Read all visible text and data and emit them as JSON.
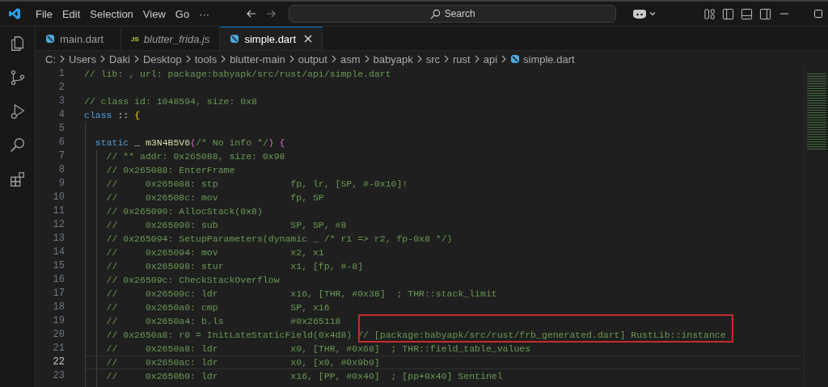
{
  "title_bar": {
    "menu": [
      "File",
      "Edit",
      "Selection",
      "View",
      "Go",
      "···"
    ],
    "search": {
      "placeholder": "Search"
    }
  },
  "tabs": [
    {
      "label": "main.dart",
      "kind": "dart",
      "selected": false,
      "preview": false
    },
    {
      "label": "blutter_frida.js",
      "kind": "js",
      "badge": "JS",
      "selected": false,
      "preview": true
    },
    {
      "label": "simple.dart",
      "kind": "dart",
      "selected": true,
      "preview": false
    }
  ],
  "breadcrumbs": [
    "C:",
    "Users",
    "Daki",
    "Desktop",
    "tools",
    "blutter-main",
    "output",
    "asm",
    "babyapk",
    "src",
    "rust",
    "api",
    "simple.dart"
  ],
  "editor": {
    "lines": [
      {
        "number": "1",
        "current": false,
        "tokens": [
          {
            "kind": "comment",
            "text": "// lib: , url: package:babyapk/src/rust/api/simple.dart"
          }
        ]
      },
      {
        "number": "2",
        "current": false
      },
      {
        "number": "3",
        "current": false,
        "tokens": [
          {
            "kind": "comment",
            "text": "// class id: 1048594, size: 0x8"
          }
        ]
      },
      {
        "number": "4",
        "current": false,
        "tokens": [
          {
            "kind": "keyword",
            "text": "class"
          },
          {
            "kind": "plain",
            "text": " :: "
          },
          {
            "kind": "brace",
            "text": "{"
          }
        ]
      },
      {
        "number": "5",
        "current": false
      },
      {
        "number": "6",
        "current": false,
        "tokens": [
          {
            "kind": "keyword",
            "text": "  static"
          },
          {
            "kind": "plain",
            "text": " _ "
          },
          {
            "kind": "function",
            "text": "m3N4B5V6"
          },
          {
            "kind": "paren",
            "text": "("
          },
          {
            "kind": "comment",
            "text": "/* No info */"
          },
          {
            "kind": "paren",
            "text": ") {"
          }
        ]
      },
      {
        "number": "7",
        "current": false,
        "tokens": [
          {
            "kind": "comment",
            "text": "    // ** addr: 0x265088, size: 0x98"
          }
        ]
      },
      {
        "number": "8",
        "current": false,
        "tokens": [
          {
            "kind": "comment",
            "text": "    // 0x265088: EnterFrame"
          }
        ]
      },
      {
        "number": "9",
        "current": false,
        "tokens": [
          {
            "kind": "comment",
            "text": "    //     0x265088: stp             fp, lr, [SP, #-0x10]!"
          }
        ]
      },
      {
        "number": "10",
        "current": false,
        "tokens": [
          {
            "kind": "comment",
            "text": "    //     0x26508c: mov             fp, SP"
          }
        ]
      },
      {
        "number": "11",
        "current": false,
        "tokens": [
          {
            "kind": "comment",
            "text": "    // 0x265090: AllocStack(0x8)"
          }
        ]
      },
      {
        "number": "12",
        "current": false,
        "tokens": [
          {
            "kind": "comment",
            "text": "    //     0x265090: sub             SP, SP, #8"
          }
        ]
      },
      {
        "number": "13",
        "current": false,
        "tokens": [
          {
            "kind": "comment",
            "text": "    // 0x265094: SetupParameters(dynamic _ /* r1 => r2, fp-0x8 */)"
          }
        ]
      },
      {
        "number": "14",
        "current": false,
        "tokens": [
          {
            "kind": "comment",
            "text": "    //     0x265094: mov             x2, x1"
          }
        ]
      },
      {
        "number": "15",
        "current": false,
        "tokens": [
          {
            "kind": "comment",
            "text": "    //     0x265098: stur            x1, [fp, #-8]"
          }
        ]
      },
      {
        "number": "16",
        "current": false,
        "tokens": [
          {
            "kind": "comment",
            "text": "    // 0x26509c: CheckStackOverflow"
          }
        ]
      },
      {
        "number": "17",
        "current": false,
        "tokens": [
          {
            "kind": "comment",
            "text": "    //     0x26509c: ldr             x16, [THR, #0x38]  ; THR::stack_limit"
          }
        ]
      },
      {
        "number": "18",
        "current": false,
        "tokens": [
          {
            "kind": "comment",
            "text": "    //     0x2650a0: cmp             SP, x16"
          }
        ]
      },
      {
        "number": "19",
        "current": false,
        "tokens": [
          {
            "kind": "comment",
            "text": "    //     0x2650a4: b.ls            #0x265118"
          }
        ]
      },
      {
        "number": "20",
        "current": false,
        "tokens": [
          {
            "kind": "comment",
            "text": "    // 0x2650a8: r0 = InitLateStaticField(0x4d8) // [package:babyapk/src/rust/frb_generated.dart] RustLib::instance"
          }
        ]
      },
      {
        "number": "21",
        "current": false,
        "tokens": [
          {
            "kind": "comment",
            "text": "    //     0x2650a8: ldr             x0, [THR, #0x68]  ; THR::field_table_values"
          }
        ]
      },
      {
        "number": "22",
        "current": true,
        "tokens": [
          {
            "kind": "comment",
            "text": "    //     0x2650ac: ldr             x0, [x0, #0x9b0]"
          }
        ]
      },
      {
        "number": "23",
        "current": false,
        "tokens": [
          {
            "kind": "comment",
            "text": "    //     0x2650b0: ldr             x16, [PP, #0x40]  ; [pp+0x40] Sentinel"
          }
        ]
      }
    ]
  }
}
